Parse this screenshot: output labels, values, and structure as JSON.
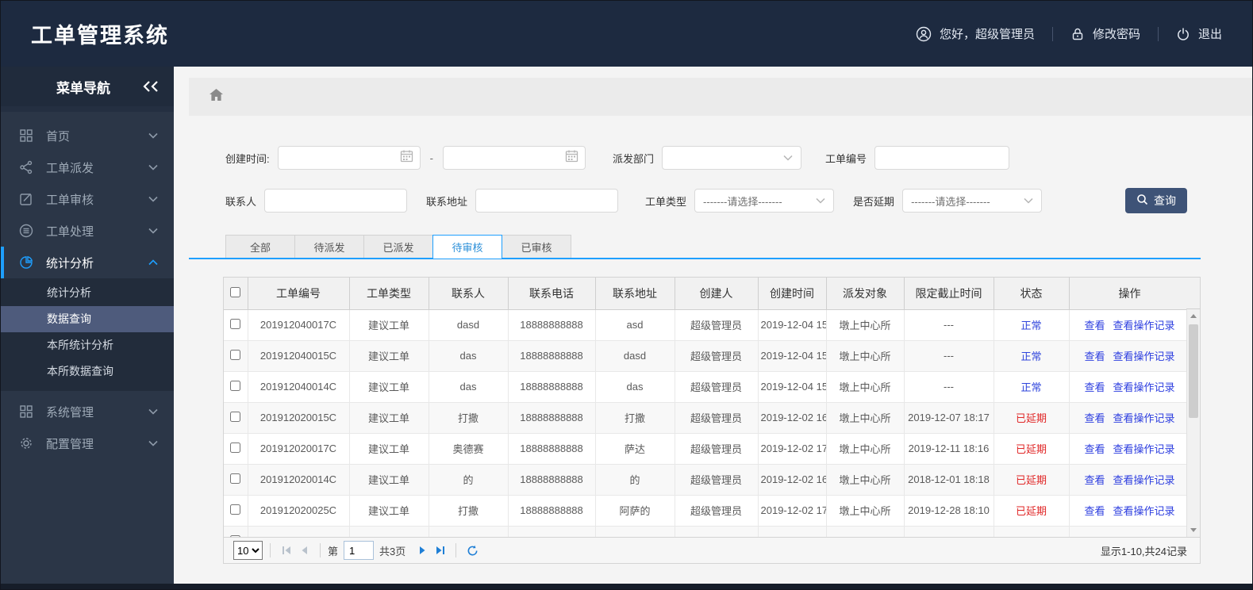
{
  "app": {
    "title": "工单管理系统"
  },
  "header": {
    "greeting": "您好，超级管理员",
    "change_password": "修改密码",
    "logout": "退出"
  },
  "sidebar": {
    "title": "菜单导航",
    "items": [
      {
        "label": "首页",
        "icon": "grid-icon"
      },
      {
        "label": "工单派发",
        "icon": "share-icon"
      },
      {
        "label": "工单审核",
        "icon": "edit-icon"
      },
      {
        "label": "工单处理",
        "icon": "layers-icon"
      },
      {
        "label": "统计分析",
        "icon": "pie-chart-icon",
        "active": true,
        "children": [
          {
            "label": "统计分析"
          },
          {
            "label": "数据查询",
            "active": true
          },
          {
            "label": "本所统计分析"
          },
          {
            "label": "本所数据查询"
          }
        ]
      },
      {
        "label": "系统管理",
        "icon": "modules-icon"
      },
      {
        "label": "配置管理",
        "icon": "gear-icon"
      }
    ]
  },
  "filters": {
    "create_time": {
      "label": "创建时间:",
      "start_value": "",
      "end_value": "",
      "separator": "-"
    },
    "dispatch_dept": {
      "label": "派发部门",
      "value": ""
    },
    "order_no": {
      "label": "工单编号",
      "value": ""
    },
    "contact": {
      "label": "联系人",
      "value": ""
    },
    "contact_address": {
      "label": "联系地址",
      "value": ""
    },
    "order_type": {
      "label": "工单类型",
      "value": "-------请选择-------"
    },
    "is_delayed": {
      "label": "是否延期",
      "value": "-------请选择-------"
    },
    "search_button": "查询"
  },
  "tabs": [
    {
      "label": "全部"
    },
    {
      "label": "待派发"
    },
    {
      "label": "已派发"
    },
    {
      "label": "待审核",
      "active": true
    },
    {
      "label": "已审核"
    }
  ],
  "table": {
    "columns": [
      "工单编号",
      "工单类型",
      "联系人",
      "联系电话",
      "联系地址",
      "创建人",
      "创建时间",
      "派发对象",
      "限定截止时间",
      "状态",
      "操作"
    ],
    "actions": {
      "view": "查看",
      "view_log": "查看操作记录"
    },
    "rows": [
      {
        "order_no": "201912040017C",
        "type": "建议工单",
        "contact": "dasd",
        "phone": "18888888888",
        "address": "asd",
        "creator": "超级管理员",
        "created": "2019-12-04 15",
        "target": "墩上中心所",
        "deadline": "---",
        "status": "正常",
        "status_color": "normal"
      },
      {
        "order_no": "201912040015C",
        "type": "建议工单",
        "contact": "das",
        "phone": "18888888888",
        "address": "dasd",
        "creator": "超级管理员",
        "created": "2019-12-04 15",
        "target": "墩上中心所",
        "deadline": "---",
        "status": "正常",
        "status_color": "normal"
      },
      {
        "order_no": "201912040014C",
        "type": "建议工单",
        "contact": "das",
        "phone": "18888888888",
        "address": "das",
        "creator": "超级管理员",
        "created": "2019-12-04 15",
        "target": "墩上中心所",
        "deadline": "---",
        "status": "正常",
        "status_color": "normal"
      },
      {
        "order_no": "201912020015C",
        "type": "建议工单",
        "contact": "打撒",
        "phone": "18888888888",
        "address": "打撒",
        "creator": "超级管理员",
        "created": "2019-12-02 16",
        "target": "墩上中心所",
        "deadline": "2019-12-07 18:17",
        "status": "已延期",
        "status_color": "delayed"
      },
      {
        "order_no": "201912020017C",
        "type": "建议工单",
        "contact": "奥德赛",
        "phone": "18888888888",
        "address": "萨达",
        "creator": "超级管理员",
        "created": "2019-12-02 17",
        "target": "墩上中心所",
        "deadline": "2019-12-11 18:16",
        "status": "已延期",
        "status_color": "delayed"
      },
      {
        "order_no": "201912020014C",
        "type": "建议工单",
        "contact": "的",
        "phone": "18888888888",
        "address": "的",
        "creator": "超级管理员",
        "created": "2019-12-02 16",
        "target": "墩上中心所",
        "deadline": "2018-12-01 18:18",
        "status": "已延期",
        "status_color": "delayed"
      },
      {
        "order_no": "201912020025C",
        "type": "建议工单",
        "contact": "打撒",
        "phone": "18888888888",
        "address": "阿萨的",
        "creator": "超级管理员",
        "created": "2019-12-02 17",
        "target": "墩上中心所",
        "deadline": "2019-12-28 18:10",
        "status": "已延期",
        "status_color": "delayed"
      }
    ]
  },
  "pagination": {
    "page_size": "10",
    "page_prefix": "第",
    "current_page": "1",
    "total_pages": "共3页",
    "summary": "显示1-10,共24记录"
  },
  "colors": {
    "header_bg": "#1d2a40",
    "sidebar_bg": "#2b3647",
    "accent_blue": "#1E9FFF",
    "button_navy": "#3E5377",
    "status_normal": "#2F45DC",
    "status_delayed": "#E02626",
    "link_blue": "#2B3CDF"
  }
}
